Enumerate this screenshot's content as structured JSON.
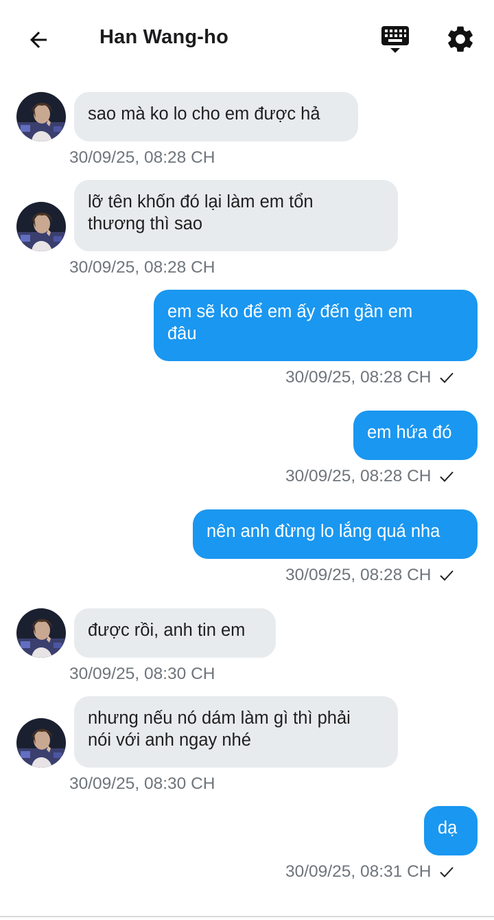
{
  "header": {
    "title": "Han Wang-ho",
    "back_icon": "arrow-left-icon",
    "keyboard_icon": "keyboard-icon",
    "settings_icon": "gear-icon"
  },
  "colors": {
    "incoming_bubble": "#e8ebee",
    "outgoing_bubble": "#1a97f0",
    "timestamp": "#6f757b"
  },
  "messages": [
    {
      "direction": "in",
      "text": "sao mà ko lo cho em được hả",
      "time": "30/09/25, 08:28 CH"
    },
    {
      "direction": "in",
      "text": "lỡ tên khốn đó lại làm em tổn\nthương thì sao",
      "time": "30/09/25, 08:28 CH"
    },
    {
      "direction": "out",
      "text": "em sẽ ko để em ấy đến gần em\nđâu",
      "time": "30/09/25, 08:28 CH",
      "status_icon": "check-icon"
    },
    {
      "direction": "out",
      "text": "em hứa đó",
      "time": "30/09/25, 08:28 CH",
      "status_icon": "check-icon"
    },
    {
      "direction": "out",
      "text": "nên anh đừng lo lắng quá nha",
      "time": "30/09/25, 08:28 CH",
      "status_icon": "check-icon"
    },
    {
      "direction": "in",
      "text": "được rồi, anh tin em",
      "time": "30/09/25, 08:30 CH"
    },
    {
      "direction": "in",
      "text": "nhưng nếu nó dám làm gì thì phải\nnói với anh ngay nhé",
      "time": "30/09/25, 08:30 CH"
    },
    {
      "direction": "out",
      "text": "dạ",
      "time": "30/09/25, 08:31 CH",
      "status_icon": "check-icon"
    }
  ]
}
